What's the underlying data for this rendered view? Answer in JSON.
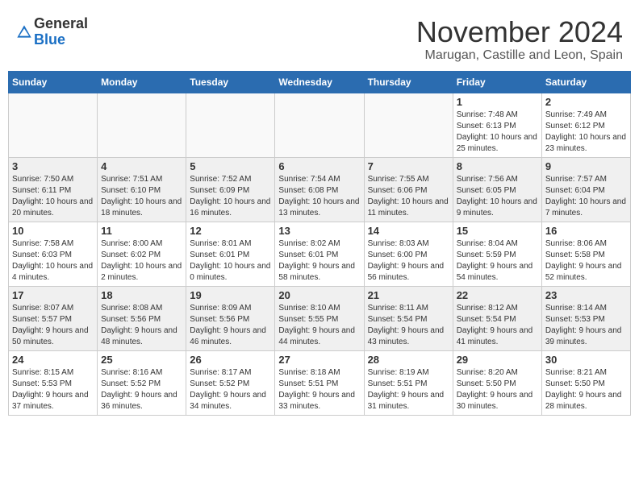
{
  "header": {
    "logo_line1": "General",
    "logo_line2": "Blue",
    "month": "November 2024",
    "location": "Marugan, Castille and Leon, Spain"
  },
  "weekdays": [
    "Sunday",
    "Monday",
    "Tuesday",
    "Wednesday",
    "Thursday",
    "Friday",
    "Saturday"
  ],
  "weeks": [
    [
      {
        "day": "",
        "info": ""
      },
      {
        "day": "",
        "info": ""
      },
      {
        "day": "",
        "info": ""
      },
      {
        "day": "",
        "info": ""
      },
      {
        "day": "",
        "info": ""
      },
      {
        "day": "1",
        "info": "Sunrise: 7:48 AM\nSunset: 6:13 PM\nDaylight: 10 hours and 25 minutes."
      },
      {
        "day": "2",
        "info": "Sunrise: 7:49 AM\nSunset: 6:12 PM\nDaylight: 10 hours and 23 minutes."
      }
    ],
    [
      {
        "day": "3",
        "info": "Sunrise: 7:50 AM\nSunset: 6:11 PM\nDaylight: 10 hours and 20 minutes."
      },
      {
        "day": "4",
        "info": "Sunrise: 7:51 AM\nSunset: 6:10 PM\nDaylight: 10 hours and 18 minutes."
      },
      {
        "day": "5",
        "info": "Sunrise: 7:52 AM\nSunset: 6:09 PM\nDaylight: 10 hours and 16 minutes."
      },
      {
        "day": "6",
        "info": "Sunrise: 7:54 AM\nSunset: 6:08 PM\nDaylight: 10 hours and 13 minutes."
      },
      {
        "day": "7",
        "info": "Sunrise: 7:55 AM\nSunset: 6:06 PM\nDaylight: 10 hours and 11 minutes."
      },
      {
        "day": "8",
        "info": "Sunrise: 7:56 AM\nSunset: 6:05 PM\nDaylight: 10 hours and 9 minutes."
      },
      {
        "day": "9",
        "info": "Sunrise: 7:57 AM\nSunset: 6:04 PM\nDaylight: 10 hours and 7 minutes."
      }
    ],
    [
      {
        "day": "10",
        "info": "Sunrise: 7:58 AM\nSunset: 6:03 PM\nDaylight: 10 hours and 4 minutes."
      },
      {
        "day": "11",
        "info": "Sunrise: 8:00 AM\nSunset: 6:02 PM\nDaylight: 10 hours and 2 minutes."
      },
      {
        "day": "12",
        "info": "Sunrise: 8:01 AM\nSunset: 6:01 PM\nDaylight: 10 hours and 0 minutes."
      },
      {
        "day": "13",
        "info": "Sunrise: 8:02 AM\nSunset: 6:01 PM\nDaylight: 9 hours and 58 minutes."
      },
      {
        "day": "14",
        "info": "Sunrise: 8:03 AM\nSunset: 6:00 PM\nDaylight: 9 hours and 56 minutes."
      },
      {
        "day": "15",
        "info": "Sunrise: 8:04 AM\nSunset: 5:59 PM\nDaylight: 9 hours and 54 minutes."
      },
      {
        "day": "16",
        "info": "Sunrise: 8:06 AM\nSunset: 5:58 PM\nDaylight: 9 hours and 52 minutes."
      }
    ],
    [
      {
        "day": "17",
        "info": "Sunrise: 8:07 AM\nSunset: 5:57 PM\nDaylight: 9 hours and 50 minutes."
      },
      {
        "day": "18",
        "info": "Sunrise: 8:08 AM\nSunset: 5:56 PM\nDaylight: 9 hours and 48 minutes."
      },
      {
        "day": "19",
        "info": "Sunrise: 8:09 AM\nSunset: 5:56 PM\nDaylight: 9 hours and 46 minutes."
      },
      {
        "day": "20",
        "info": "Sunrise: 8:10 AM\nSunset: 5:55 PM\nDaylight: 9 hours and 44 minutes."
      },
      {
        "day": "21",
        "info": "Sunrise: 8:11 AM\nSunset: 5:54 PM\nDaylight: 9 hours and 43 minutes."
      },
      {
        "day": "22",
        "info": "Sunrise: 8:12 AM\nSunset: 5:54 PM\nDaylight: 9 hours and 41 minutes."
      },
      {
        "day": "23",
        "info": "Sunrise: 8:14 AM\nSunset: 5:53 PM\nDaylight: 9 hours and 39 minutes."
      }
    ],
    [
      {
        "day": "24",
        "info": "Sunrise: 8:15 AM\nSunset: 5:53 PM\nDaylight: 9 hours and 37 minutes."
      },
      {
        "day": "25",
        "info": "Sunrise: 8:16 AM\nSunset: 5:52 PM\nDaylight: 9 hours and 36 minutes."
      },
      {
        "day": "26",
        "info": "Sunrise: 8:17 AM\nSunset: 5:52 PM\nDaylight: 9 hours and 34 minutes."
      },
      {
        "day": "27",
        "info": "Sunrise: 8:18 AM\nSunset: 5:51 PM\nDaylight: 9 hours and 33 minutes."
      },
      {
        "day": "28",
        "info": "Sunrise: 8:19 AM\nSunset: 5:51 PM\nDaylight: 9 hours and 31 minutes."
      },
      {
        "day": "29",
        "info": "Sunrise: 8:20 AM\nSunset: 5:50 PM\nDaylight: 9 hours and 30 minutes."
      },
      {
        "day": "30",
        "info": "Sunrise: 8:21 AM\nSunset: 5:50 PM\nDaylight: 9 hours and 28 minutes."
      }
    ]
  ]
}
